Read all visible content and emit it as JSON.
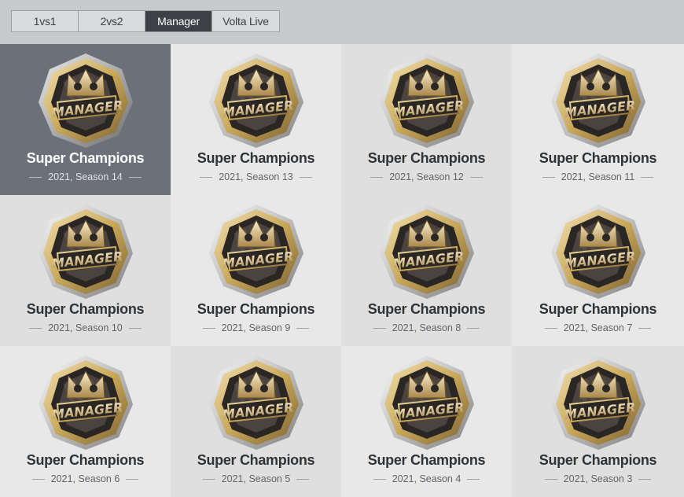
{
  "tabs": [
    {
      "label": "1vs1",
      "active": false
    },
    {
      "label": "2vs2",
      "active": false
    },
    {
      "label": "Manager",
      "active": true
    },
    {
      "label": "Volta Live",
      "active": false
    }
  ],
  "badge_text": "MANAGER",
  "cards": [
    {
      "title": "Super Champions",
      "subtitle": "2021, Season 14",
      "selected": true
    },
    {
      "title": "Super Champions",
      "subtitle": "2021, Season 13",
      "selected": false
    },
    {
      "title": "Super Champions",
      "subtitle": "2021, Season 12",
      "selected": false
    },
    {
      "title": "Super Champions",
      "subtitle": "2021, Season 11",
      "selected": false
    },
    {
      "title": "Super Champions",
      "subtitle": "2021, Season 10",
      "selected": false
    },
    {
      "title": "Super Champions",
      "subtitle": "2021, Season 9",
      "selected": false
    },
    {
      "title": "Super Champions",
      "subtitle": "2021, Season 8",
      "selected": false
    },
    {
      "title": "Super Champions",
      "subtitle": "2021, Season 7",
      "selected": false
    },
    {
      "title": "Super Champions",
      "subtitle": "2021, Season 6",
      "selected": false
    },
    {
      "title": "Super Champions",
      "subtitle": "2021, Season 5",
      "selected": false
    },
    {
      "title": "Super Champions",
      "subtitle": "2021, Season 4",
      "selected": false
    },
    {
      "title": "Super Champions",
      "subtitle": "2021, Season 3",
      "selected": false
    }
  ],
  "colors": {
    "selected_bg": "#6c7079",
    "active_tab_bg": "#3d4045",
    "gold": "#c9a85a",
    "dark": "#2a2624"
  }
}
